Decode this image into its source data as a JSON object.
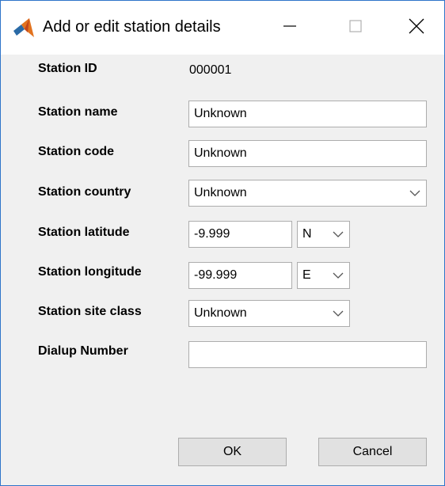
{
  "window": {
    "title": "Add or edit station details"
  },
  "form": {
    "station_id": {
      "label": "Station ID",
      "value": "000001"
    },
    "station_name": {
      "label": "Station name",
      "value": "Unknown"
    },
    "station_code": {
      "label": "Station code",
      "value": "Unknown"
    },
    "station_country": {
      "label": "Station country",
      "value": "Unknown"
    },
    "station_latitude": {
      "label": "Station latitude",
      "value": "-9.999",
      "hemisphere": "N"
    },
    "station_longitude": {
      "label": "Station longitude",
      "value": "-99.999",
      "hemisphere": "E"
    },
    "station_site_class": {
      "label": "Station site class",
      "value": "Unknown"
    },
    "dialup_number": {
      "label": "Dialup Number",
      "value": ""
    }
  },
  "buttons": {
    "ok": "OK",
    "cancel": "Cancel"
  },
  "colors": {
    "window_border": "#2f74c9",
    "dialog_background": "#f0f0f0",
    "button_background": "#e1e1e1",
    "field_border": "#adadad"
  },
  "icons": {
    "app": "matlab-logo-icon",
    "minimize": "minimize-icon",
    "maximize": "maximize-icon",
    "close": "close-icon",
    "dropdown": "chevron-down-icon"
  }
}
